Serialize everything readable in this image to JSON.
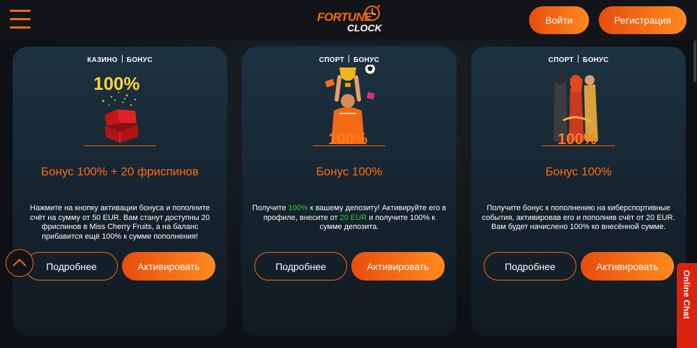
{
  "header": {
    "logo_line1": "FORTUNE",
    "logo_line2": "CLOCK",
    "login_label": "Войти",
    "register_label": "Регистрация",
    "menu_icon": "hamburger-icon"
  },
  "cards": [
    {
      "tag1": "КАЗИНО",
      "tag2": "БОНУС",
      "badge": "100%",
      "title": "Бонус 100% + 20 фриспинов",
      "desc": "Нажмите на кнопку активации бонуса и пополните счёт на сумму от 50 EUR. Вам станут доступны 20 фриспинов в Miss Cherry Fruits, а на баланс прибавится ещё 100% к сумме пополнения!",
      "more_label": "Подробнее",
      "activate_label": "Активировать"
    },
    {
      "tag1": "СПОРТ",
      "tag2": "БОНУС",
      "badge": "100%",
      "title": "Бонус 100%",
      "desc_part1": "Получите ",
      "desc_hl1": "100%",
      "desc_part2": " к вашему депозиту! Активируйте его в профиле, внесите от ",
      "desc_hl2": "20 EUR",
      "desc_part3": " и получите 100% к сумме депозита.",
      "more_label": "Подробнее",
      "activate_label": "Активировать"
    },
    {
      "tag1": "СПОРТ",
      "tag2": "БОНУС",
      "badge": "100%",
      "title": "Бонус 100%",
      "desc": "Получите бонус к пополнению на киберспортивные события, активировав его и пополнив счёт от 20 EUR. Вам будет начислено 100% ко внесённой сумме.",
      "more_label": "Подробнее",
      "activate_label": "Активировать"
    }
  ],
  "online_chat": {
    "label": "Online Chat"
  },
  "colors": {
    "accent": "#ff6a13",
    "highlight": "#2bd93c",
    "chat": "#d9230f",
    "background": "#0d0f12"
  }
}
